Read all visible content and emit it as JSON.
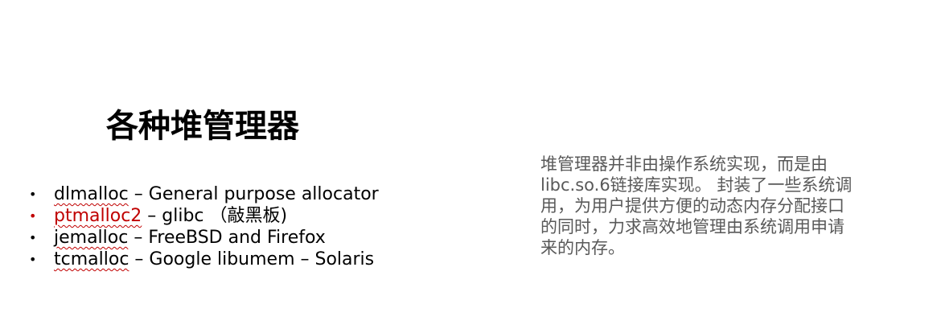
{
  "slide": {
    "title": "各种堆管理器",
    "bullets": [
      {
        "name": "dlmalloc",
        "rest": " – General purpose allocator",
        "highlight": false
      },
      {
        "name": "ptmalloc2",
        "rest": " – glibc （敲黑板)",
        "highlight": true
      },
      {
        "name": "jemalloc",
        "rest": " – FreeBSD and Firefox",
        "highlight": false
      },
      {
        "name": "tcmalloc",
        "rest": " – Google libumem – Solaris",
        "highlight": false
      }
    ],
    "bullet_symbol": "•",
    "side_note_lines": [
      "堆管理器并非由操作系统实现，而是由",
      "libc.so.6链接库实现。 封装了一些系统调",
      "用，为用户提供方便的动态内存分配接口",
      "的同时，力求高效地管理由系统调用申请",
      "来的内存。"
    ],
    "colors": {
      "title": "#000000",
      "highlight": "#c00000",
      "side_note": "#595959"
    }
  }
}
